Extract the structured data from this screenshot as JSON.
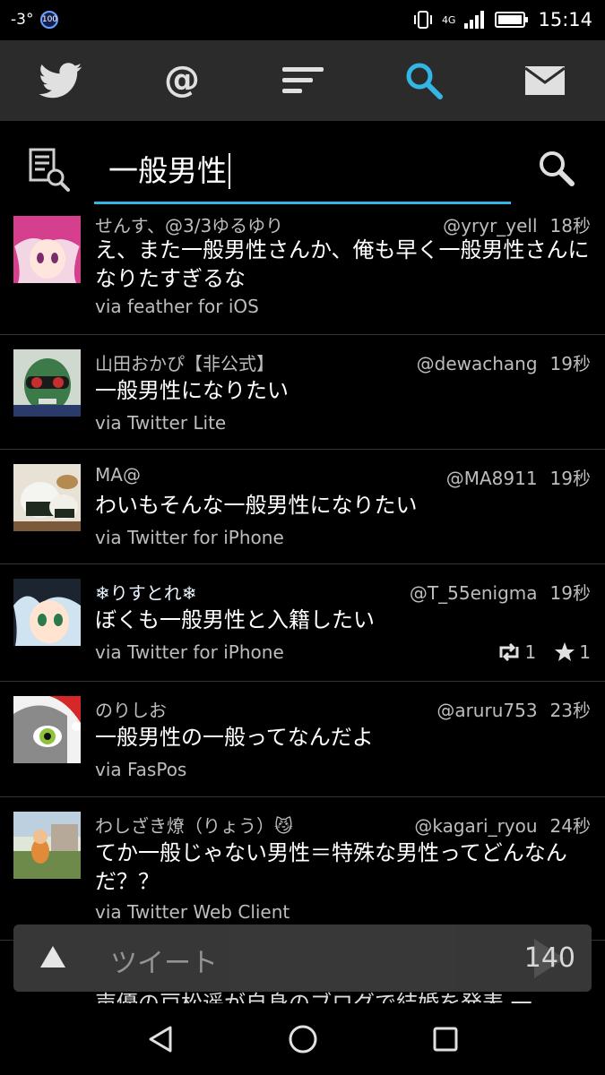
{
  "status_bar": {
    "temperature": "-3°",
    "badge": "100",
    "network": "4G",
    "time": "15:14"
  },
  "nav_tabs": [
    {
      "icon": "twitter-bird-icon",
      "active": false
    },
    {
      "icon": "at-icon",
      "active": false
    },
    {
      "icon": "lists-icon",
      "active": false
    },
    {
      "icon": "search-icon",
      "active": true
    },
    {
      "icon": "mail-icon",
      "active": false
    }
  ],
  "search": {
    "query": "一般男性",
    "history_icon": "search-history-icon",
    "go_icon": "search-icon"
  },
  "tweets": [
    {
      "name": "せんす、@3/3ゆるゆり",
      "handle": "@yryr_yell",
      "time": "18秒",
      "text": "え、また一般男性さんか、俺も早く一般男性さんになりたすぎるな",
      "via": "via feather for iOS"
    },
    {
      "name": "山田おかぴ【非公式】",
      "handle": "@dewachang",
      "time": "19秒",
      "text": "一般男性になりたい",
      "via": "via Twitter Lite"
    },
    {
      "name": "MA@",
      "handle": "@MA8911",
      "time": "19秒",
      "text": "わいもそんな一般男性になりたい",
      "via": "via Twitter for iPhone"
    },
    {
      "name": "❄りすとれ❄",
      "handle": "@T_55enigma",
      "time": "19秒",
      "text": "ぼくも一般男性と入籍したい",
      "via": "via Twitter for iPhone",
      "retweets": "1",
      "favorites": "1"
    },
    {
      "name": "のりしお",
      "handle": "@aruru753",
      "time": "23秒",
      "text": "一般男性の一般ってなんだよ",
      "via": "via FasPos"
    },
    {
      "name": "わしざき燎（りょう）😼",
      "handle": "@kagari_ryou",
      "time": "24秒",
      "text": "てか一般じゃない男性＝特殊な男性ってどんなんだ？？",
      "via": "via Twitter Web Client"
    }
  ],
  "partial_tweet_text": "声優の戸松遥が自身のブログで結婚を発表 一",
  "compose": {
    "placeholder": "ツイート",
    "count": "140"
  },
  "colors": {
    "accent": "#33b5e5",
    "nav_bg": "#2b2b2b",
    "text_secondary": "#bdbdbd"
  }
}
